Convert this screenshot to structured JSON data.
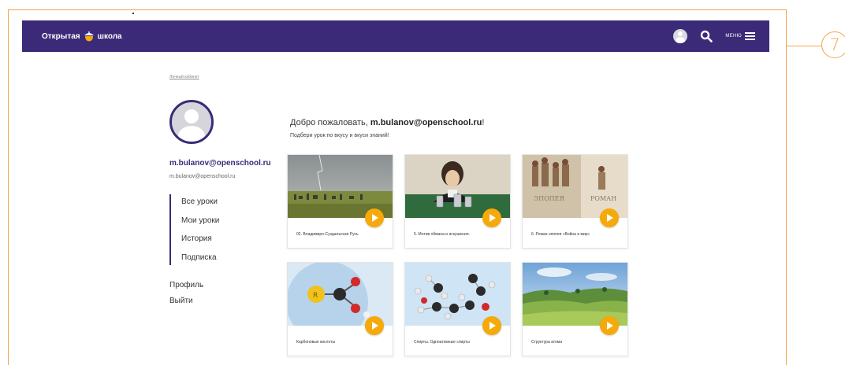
{
  "header": {
    "brand_left": "Открытая",
    "brand_right": "школа",
    "menu_label": "МЕНЮ"
  },
  "callout_number": "7",
  "breadcrumb": "Личный кабинет",
  "profile": {
    "name": "m.bulanov@openschool.ru",
    "email": "m.bulanov@openschool.ru"
  },
  "lesson_nav": {
    "items": [
      "Все уроки",
      "Мои уроки",
      "История",
      "Подписка"
    ]
  },
  "account_links": {
    "profile": "Профиль",
    "exit": "Выйти"
  },
  "welcome": {
    "greeting": "Добро пожаловать, ",
    "user": "m.bulanov@openschool.ru",
    "exclaim": "!",
    "subtitle": "Подбери урок по вкусу и вкуси знаний!"
  },
  "cards": [
    {
      "title": "02. Владимиро-Суздальская Русь",
      "thumb": "landscape-rain"
    },
    {
      "title": "5. Мотив обмана и искушения.",
      "thumb": "pushkin-cups"
    },
    {
      "title": "6. Роман-эпопея «Война и мир»",
      "thumb": "epic-novel",
      "thumb_text_left": "ЭПОПЕЯ",
      "thumb_text_right": "РОМАН"
    },
    {
      "title": "Карбоновые кислоты",
      "thumb": "molecule-carboxyl",
      "atom_label": "R"
    },
    {
      "title": "Спирты. Одноатомные спирты",
      "thumb": "molecule-alcohols"
    },
    {
      "title": "Структура атома",
      "thumb": "green-fields"
    }
  ],
  "colors": {
    "header": "#3b2a78",
    "accent": "#f5a90a",
    "frame": "#f2a44a"
  }
}
